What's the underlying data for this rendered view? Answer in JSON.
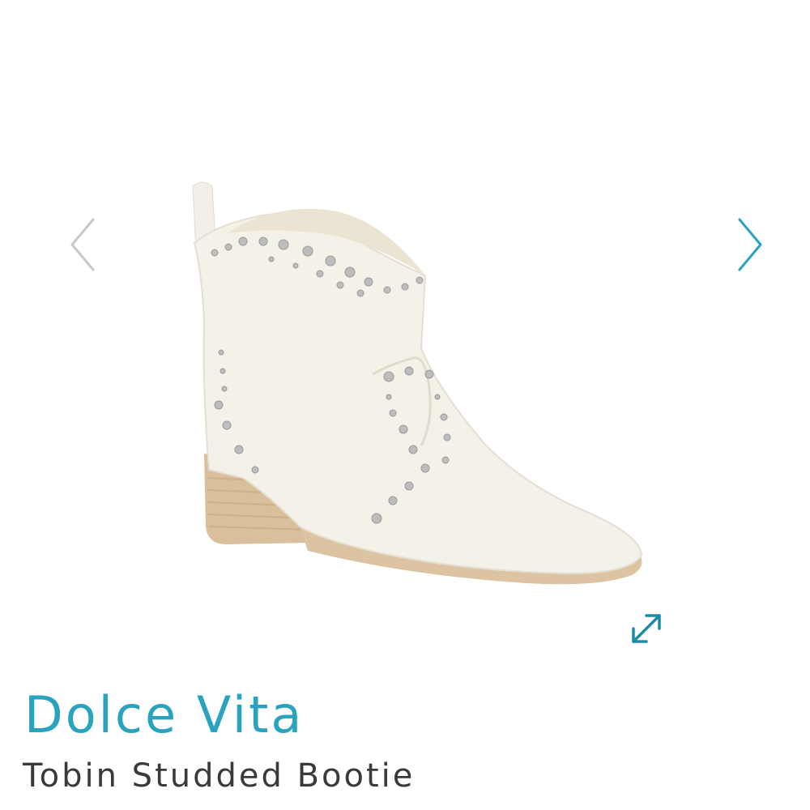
{
  "gallery": {
    "image_alt": "Dolce Vita Tobin Studded Bootie",
    "prev_icon": "chevron-left-icon",
    "next_icon": "chevron-right-icon",
    "expand_icon": "expand-icon"
  },
  "product": {
    "brand": "Dolce Vita",
    "name": "Tobin Studded Bootie"
  },
  "colors": {
    "accent": "#2aa3bf",
    "arrow_disabled": "#c8c8c8",
    "text": "#3a3a3a",
    "boot_leather": "#f2efe6",
    "boot_sole": "#dcc3a2",
    "studs": "#b9b9b9"
  }
}
